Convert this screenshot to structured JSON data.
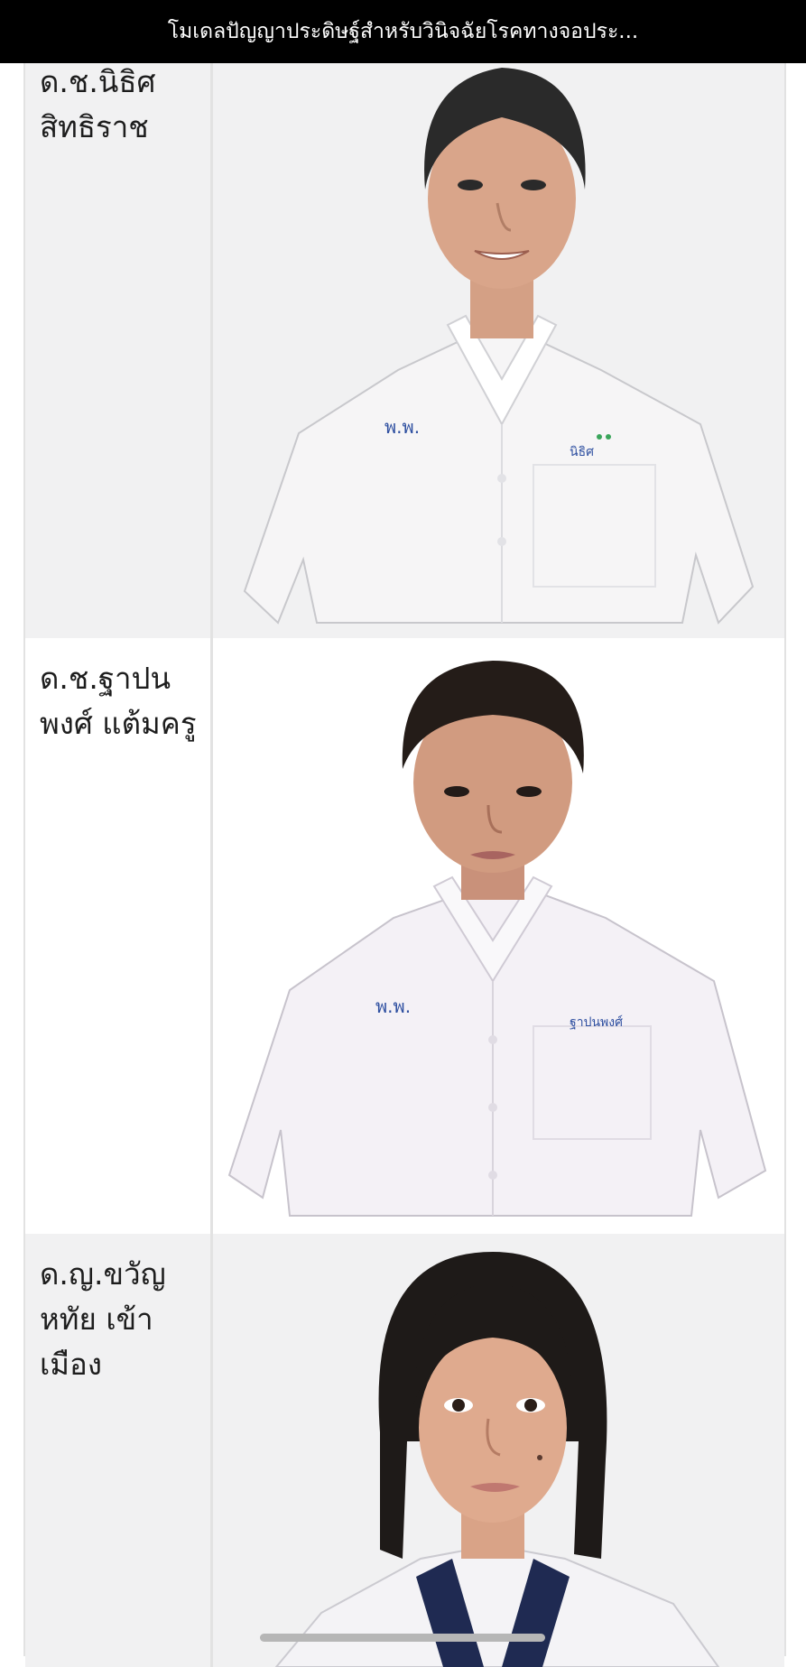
{
  "header": {
    "title": "โมเดลปัญญาประดิษฐ์สำหรับวินิจฉัยโรคทางจอประ..."
  },
  "students": [
    {
      "name": "ด.ช.นิธิศ สิทธิราช",
      "photo_icon": "student-portrait-boy-1"
    },
    {
      "name": "ด.ช.ฐาปนพงศ์ แต้มครู",
      "photo_icon": "student-portrait-boy-2"
    },
    {
      "name": "ด.ญ.ขวัญหทัย เข้าเมือง",
      "photo_icon": "student-portrait-girl-1"
    }
  ],
  "colors": {
    "topbar_bg": "#000000",
    "row_gray": "#f1f1f2",
    "row_white": "#ffffff",
    "border": "#e2e2e2",
    "shirt": "#f4f1f6",
    "hair": "#2a2a2a",
    "skin": "#d9a58a"
  }
}
